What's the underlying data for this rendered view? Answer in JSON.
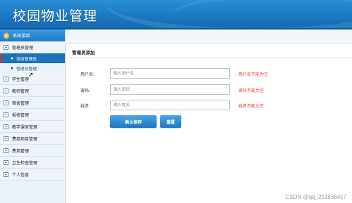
{
  "header": {
    "title": "校园物业管理"
  },
  "sidebar": {
    "heading": "系统菜单",
    "items": [
      {
        "label": "管理员管理",
        "expanded": true,
        "children": [
          {
            "label": "添加管理员",
            "active": true
          },
          {
            "label": "管理员管理"
          }
        ]
      },
      {
        "label": "学生管理"
      },
      {
        "label": "教师管理"
      },
      {
        "label": "宿舍管理"
      },
      {
        "label": "报修管理"
      },
      {
        "label": "教学课室管理"
      },
      {
        "label": "费用项目管理"
      },
      {
        "label": "费用管理"
      },
      {
        "label": "卫生检查管理"
      },
      {
        "label": "个人信息"
      }
    ]
  },
  "main": {
    "breadcrumb": "管理员添加",
    "form": {
      "username": {
        "label": "用户名:",
        "placeholder": "输入用户名",
        "value": "",
        "error": "用户名不能为空"
      },
      "password": {
        "label": "密码:",
        "placeholder": "输入密码",
        "value": "",
        "error": "密码不能为空"
      },
      "name": {
        "label": "姓名:",
        "placeholder": "输入姓名",
        "value": "",
        "error": "姓名不能为空"
      }
    },
    "buttons": {
      "save": "确认保存",
      "reset": "重置"
    }
  },
  "watermark": "CSDN @qq_251836457",
  "colors": {
    "header": "#1c78c2",
    "accent": "#1d73b7",
    "error": "#e53935"
  }
}
